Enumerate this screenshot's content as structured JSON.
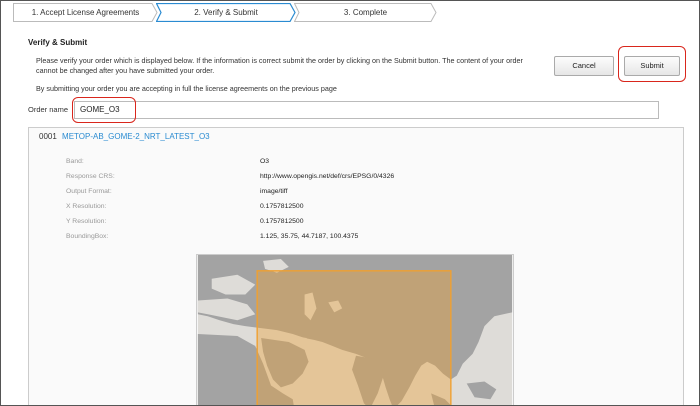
{
  "steps": [
    {
      "label": "1. Accept License Agreements",
      "active": false
    },
    {
      "label": "2. Verify & Submit",
      "active": true
    },
    {
      "label": "3. Complete",
      "active": false
    }
  ],
  "section": {
    "title": "Verify & Submit",
    "intro": "Please verify your order which is displayed below. If the information is correct submit the order by clicking on the Submit button. The content of your order cannot be changed after you have submitted your order.",
    "agree": "By submitting your order you are accepting in full the license agreements on the previous page"
  },
  "buttons": {
    "cancel": "Cancel",
    "submit": "Submit"
  },
  "order": {
    "label": "Order name",
    "value": "GOME_O3"
  },
  "product": {
    "number": "0001",
    "name": "METOP-AB_GOME-2_NRT_LATEST_O3",
    "properties": [
      {
        "key": "Band:",
        "value": "O3"
      },
      {
        "key": "Response CRS:",
        "value": "http://www.opengis.net/def/crs/EPSG/0/4326"
      },
      {
        "key": "Output Format:",
        "value": "image/tiff"
      },
      {
        "key": "X Resolution:",
        "value": "0.1757812500"
      },
      {
        "key": "Y Resolution:",
        "value": "0.1757812500"
      },
      {
        "key": "BoundingBox:",
        "value": "1.125, 35.75, 44.7187, 100.4375"
      }
    ]
  },
  "colors": {
    "accent": "#2a8bd1",
    "highlight": "#d9261c",
    "bbox": "#f0a030",
    "land": "#a3a3a3",
    "sea": "#dedcd8"
  }
}
